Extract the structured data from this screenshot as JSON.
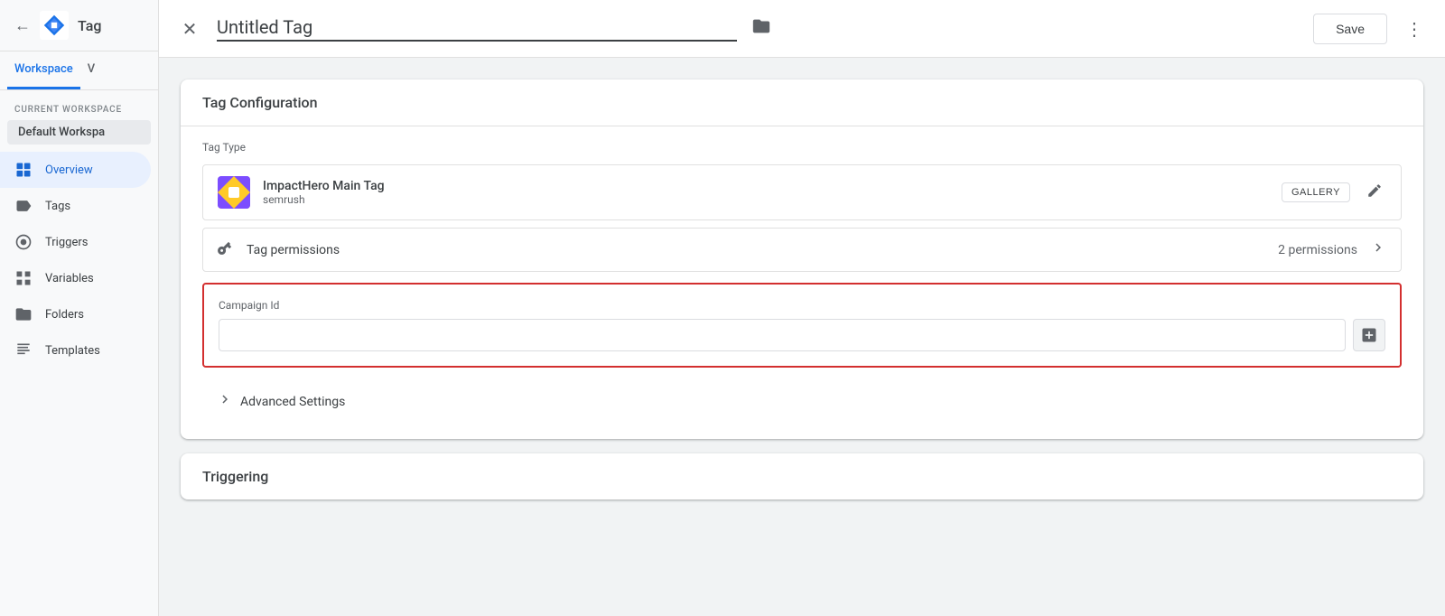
{
  "sidebar": {
    "app_title": "Tag",
    "tabs": [
      {
        "label": "Workspace",
        "active": true
      },
      {
        "label": "V",
        "active": false
      }
    ],
    "workspace_label": "CURRENT WORKSPACE",
    "workspace_name": "Default Workspa",
    "nav_items": [
      {
        "id": "overview",
        "label": "Overview",
        "icon": "■",
        "active": true
      },
      {
        "id": "tags",
        "label": "Tags",
        "icon": "▶",
        "active": false
      },
      {
        "id": "triggers",
        "label": "Triggers",
        "icon": "◎",
        "active": false
      },
      {
        "id": "variables",
        "label": "Variables",
        "icon": "⬛",
        "active": false
      },
      {
        "id": "folders",
        "label": "Folders",
        "icon": "▶",
        "active": false
      },
      {
        "id": "templates",
        "label": "Templates",
        "icon": "◁",
        "active": false
      }
    ]
  },
  "dialog": {
    "title": "Untitled Tag",
    "save_label": "Save",
    "more_options_label": "⋮"
  },
  "tag_config": {
    "section_title": "Tag Configuration",
    "tag_type_label": "Tag Type",
    "tag_name": "ImpactHero Main Tag",
    "tag_vendor": "semrush",
    "gallery_label": "GALLERY",
    "permissions_label": "Tag permissions",
    "permissions_count": "2 permissions",
    "campaign_id_label": "Campaign Id",
    "campaign_input_value": "",
    "campaign_input_placeholder": "",
    "advanced_settings_label": "Advanced Settings"
  },
  "triggering": {
    "section_title": "Triggering"
  }
}
